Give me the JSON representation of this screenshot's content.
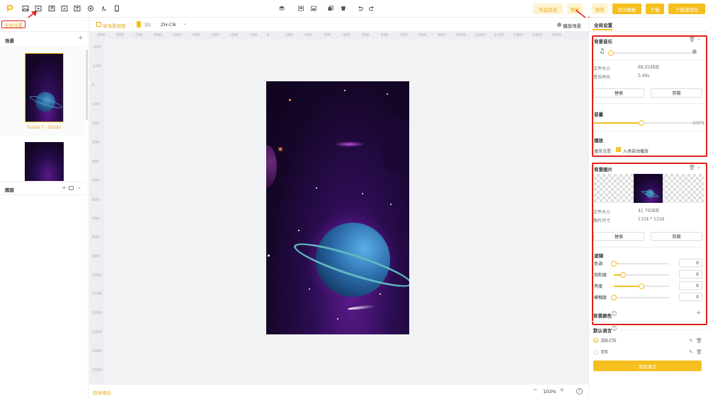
{
  "toolbar": {
    "buttons": {
      "info": "作品信息",
      "preview": "预览",
      "save": "保存",
      "save_template": "存为模板",
      "download": "下载",
      "download_package": "下载游戏包"
    }
  },
  "left": {
    "global_settings": "全局设置",
    "scenes_title": "场景",
    "scene1_label": "Scene 1 - Guide",
    "layers_title": "图层"
  },
  "center": {
    "single_scene_view": "单场景视图",
    "language": "ZH-CN",
    "play_scene": "播放场景",
    "ruler_x": [
      "-900",
      "-800",
      "-700",
      "-600",
      "-500",
      "-400",
      "-300",
      "-200",
      "-100",
      "0",
      "100",
      "200",
      "300",
      "400",
      "500",
      "600",
      "700",
      "800",
      "900",
      "1000",
      "1100",
      "1200",
      "1300",
      "1400",
      "1500"
    ],
    "ruler_y": [
      "-200",
      "-100",
      "0",
      "100",
      "200",
      "300",
      "400",
      "500",
      "600",
      "700",
      "800",
      "900",
      "1000",
      "1100",
      "1200",
      "1300",
      "1400",
      "1500"
    ],
    "package_preview": "包体预估",
    "zoom": "103%"
  },
  "right": {
    "tab_title": "全局设置",
    "music": {
      "title": "背景音乐",
      "file_size_label": "文件大小",
      "file_size": "88.024KB",
      "duration_label": "音乐时长",
      "duration": "5.49s",
      "replace": "替换",
      "crop": "剪辑",
      "volume_title": "音量",
      "volume_value": "100%",
      "volume_level": 0.5,
      "play_title": "播放",
      "play_settings_label": "播放设置",
      "autoplay_label": "入场自动播放",
      "autoplay": true
    },
    "image": {
      "title": "背景图片",
      "file_size_label": "文件大小",
      "file_size": "41.703KB",
      "dims_label": "图片尺寸",
      "dims": "1334 * 1334",
      "replace": "替换",
      "crop": "剪辑",
      "filter_title": "滤镜",
      "filters": [
        {
          "label": "色调",
          "value": "0",
          "level": 0.0
        },
        {
          "label": "饱和度",
          "value": "0",
          "level": 0.15
        },
        {
          "label": "亮度",
          "value": "0",
          "level": 0.5
        },
        {
          "label": "模糊度",
          "value": "0",
          "level": 0.0
        }
      ]
    },
    "bg_color_title": "背景颜色",
    "default_lang_title": "默认语言",
    "languages": [
      {
        "label": "ZH-CN",
        "selected": true
      },
      {
        "label": "EN",
        "selected": false
      }
    ],
    "add_language": "添加语言"
  },
  "colors": {
    "accent": "#f5bf1d",
    "highlight": "#e0201a"
  }
}
